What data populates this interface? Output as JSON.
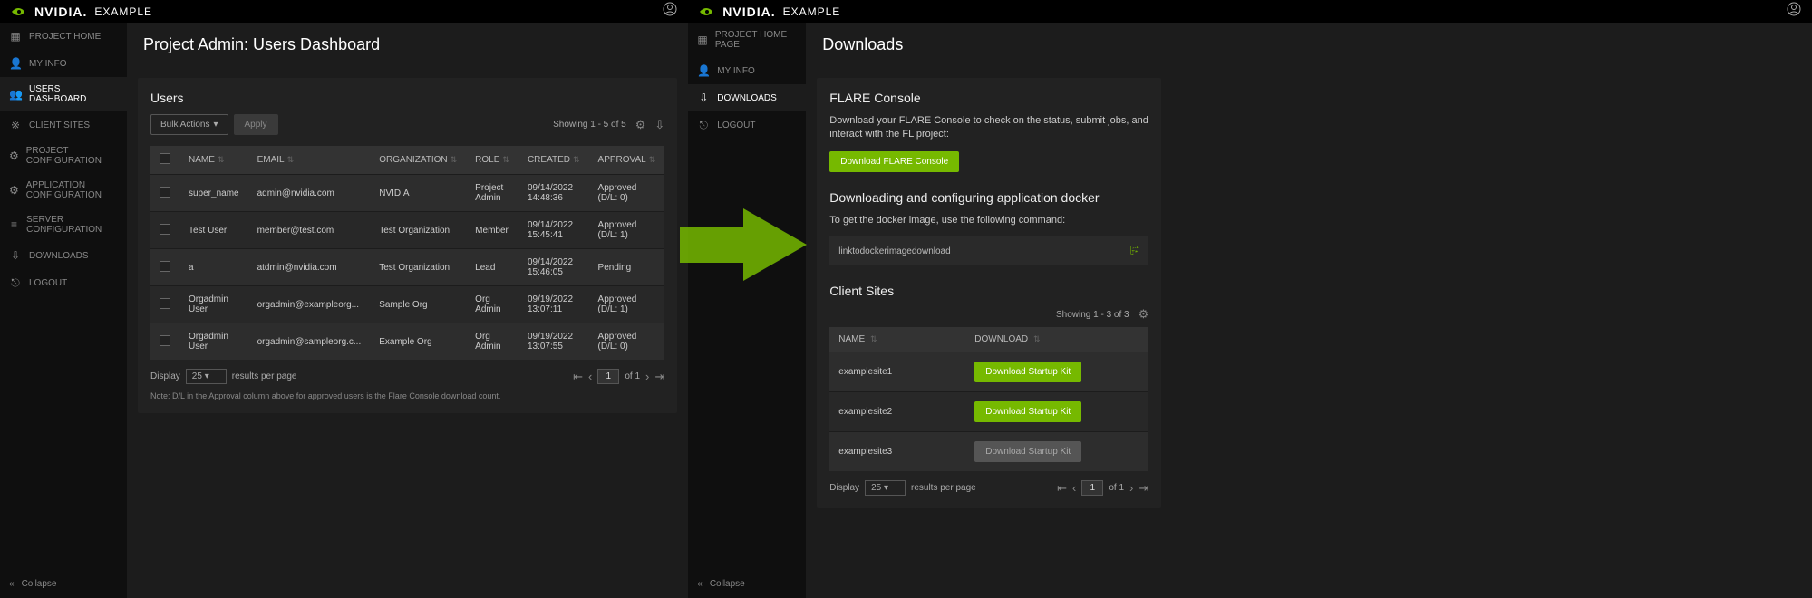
{
  "brand": {
    "name": "NVIDIA.",
    "tag": "EXAMPLE"
  },
  "left": {
    "sidebar": {
      "items": [
        {
          "icon": "home",
          "label": "PROJECT HOME"
        },
        {
          "icon": "user",
          "label": "MY INFO"
        },
        {
          "icon": "users",
          "label": "USERS DASHBOARD",
          "active": true
        },
        {
          "icon": "sites",
          "label": "CLIENT SITES"
        },
        {
          "icon": "cfg",
          "label": "PROJECT CONFIGURATION"
        },
        {
          "icon": "cfg",
          "label": "APPLICATION CONFIGURATION"
        },
        {
          "icon": "server",
          "label": "SERVER CONFIGURATION"
        },
        {
          "icon": "download",
          "label": "DOWNLOADS"
        },
        {
          "icon": "logout",
          "label": "LOGOUT"
        }
      ],
      "collapse": "Collapse"
    },
    "page_title": "Project Admin: Users Dashboard",
    "users": {
      "title": "Users",
      "bulk_label": "Bulk Actions",
      "apply_label": "Apply",
      "showing": "Showing 1 - 5 of 5",
      "columns": [
        "NAME",
        "EMAIL",
        "ORGANIZATION",
        "ROLE",
        "CREATED",
        "APPROVAL"
      ],
      "rows": [
        {
          "name": "super_name",
          "email": "admin@nvidia.com",
          "org": "NVIDIA",
          "role": "Project Admin",
          "created": "09/14/2022 14:48:36",
          "approval": "Approved (D/L: 0)"
        },
        {
          "name": "Test User",
          "email": "member@test.com",
          "org": "Test Organization",
          "role": "Member",
          "created": "09/14/2022 15:45:41",
          "approval": "Approved (D/L: 1)"
        },
        {
          "name": "a",
          "email": "atdmin@nvidia.com",
          "org": "Test Organization",
          "role": "Lead",
          "created": "09/14/2022 15:46:05",
          "approval": "Pending"
        },
        {
          "name": "Orgadmin User",
          "email": "orgadmin@exampleorg...",
          "org": "Sample Org",
          "role": "Org Admin",
          "created": "09/19/2022 13:07:11",
          "approval": "Approved (D/L: 1)"
        },
        {
          "name": "Orgadmin User",
          "email": "orgadmin@sampleorg.c...",
          "org": "Example Org",
          "role": "Org Admin",
          "created": "09/19/2022 13:07:55",
          "approval": "Approved (D/L: 0)"
        }
      ],
      "display_label": "Display",
      "per_page_value": "25",
      "results_label": "results per page",
      "page_value": "1",
      "of_label": "of 1",
      "note": "Note: D/L in the Approval column above for approved users is the Flare Console download count."
    }
  },
  "right": {
    "sidebar": {
      "items": [
        {
          "icon": "home",
          "label": "PROJECT HOME PAGE"
        },
        {
          "icon": "user",
          "label": "MY INFO"
        },
        {
          "icon": "download",
          "label": "DOWNLOADS",
          "active": true
        },
        {
          "icon": "logout",
          "label": "LOGOUT"
        }
      ],
      "collapse": "Collapse"
    },
    "page_title": "Downloads",
    "flare": {
      "title": "FLARE Console",
      "desc": "Download your FLARE Console to check on the status, submit jobs, and interact with the FL project:",
      "button": "Download FLARE Console"
    },
    "docker": {
      "title": "Downloading and configuring application docker",
      "desc": "To get the docker image, use the following command:",
      "code": "linktodockerimagedownload"
    },
    "clients": {
      "title": "Client Sites",
      "showing": "Showing 1 - 3 of 3",
      "columns": [
        "NAME",
        "DOWNLOAD"
      ],
      "rows": [
        {
          "name": "examplesite1",
          "btn": "Download Startup Kit",
          "enabled": true
        },
        {
          "name": "examplesite2",
          "btn": "Download Startup Kit",
          "enabled": true
        },
        {
          "name": "examplesite3",
          "btn": "Download Startup Kit",
          "enabled": false
        }
      ],
      "display_label": "Display",
      "per_page_value": "25",
      "results_label": "results per page",
      "page_value": "1",
      "of_label": "of 1"
    }
  }
}
